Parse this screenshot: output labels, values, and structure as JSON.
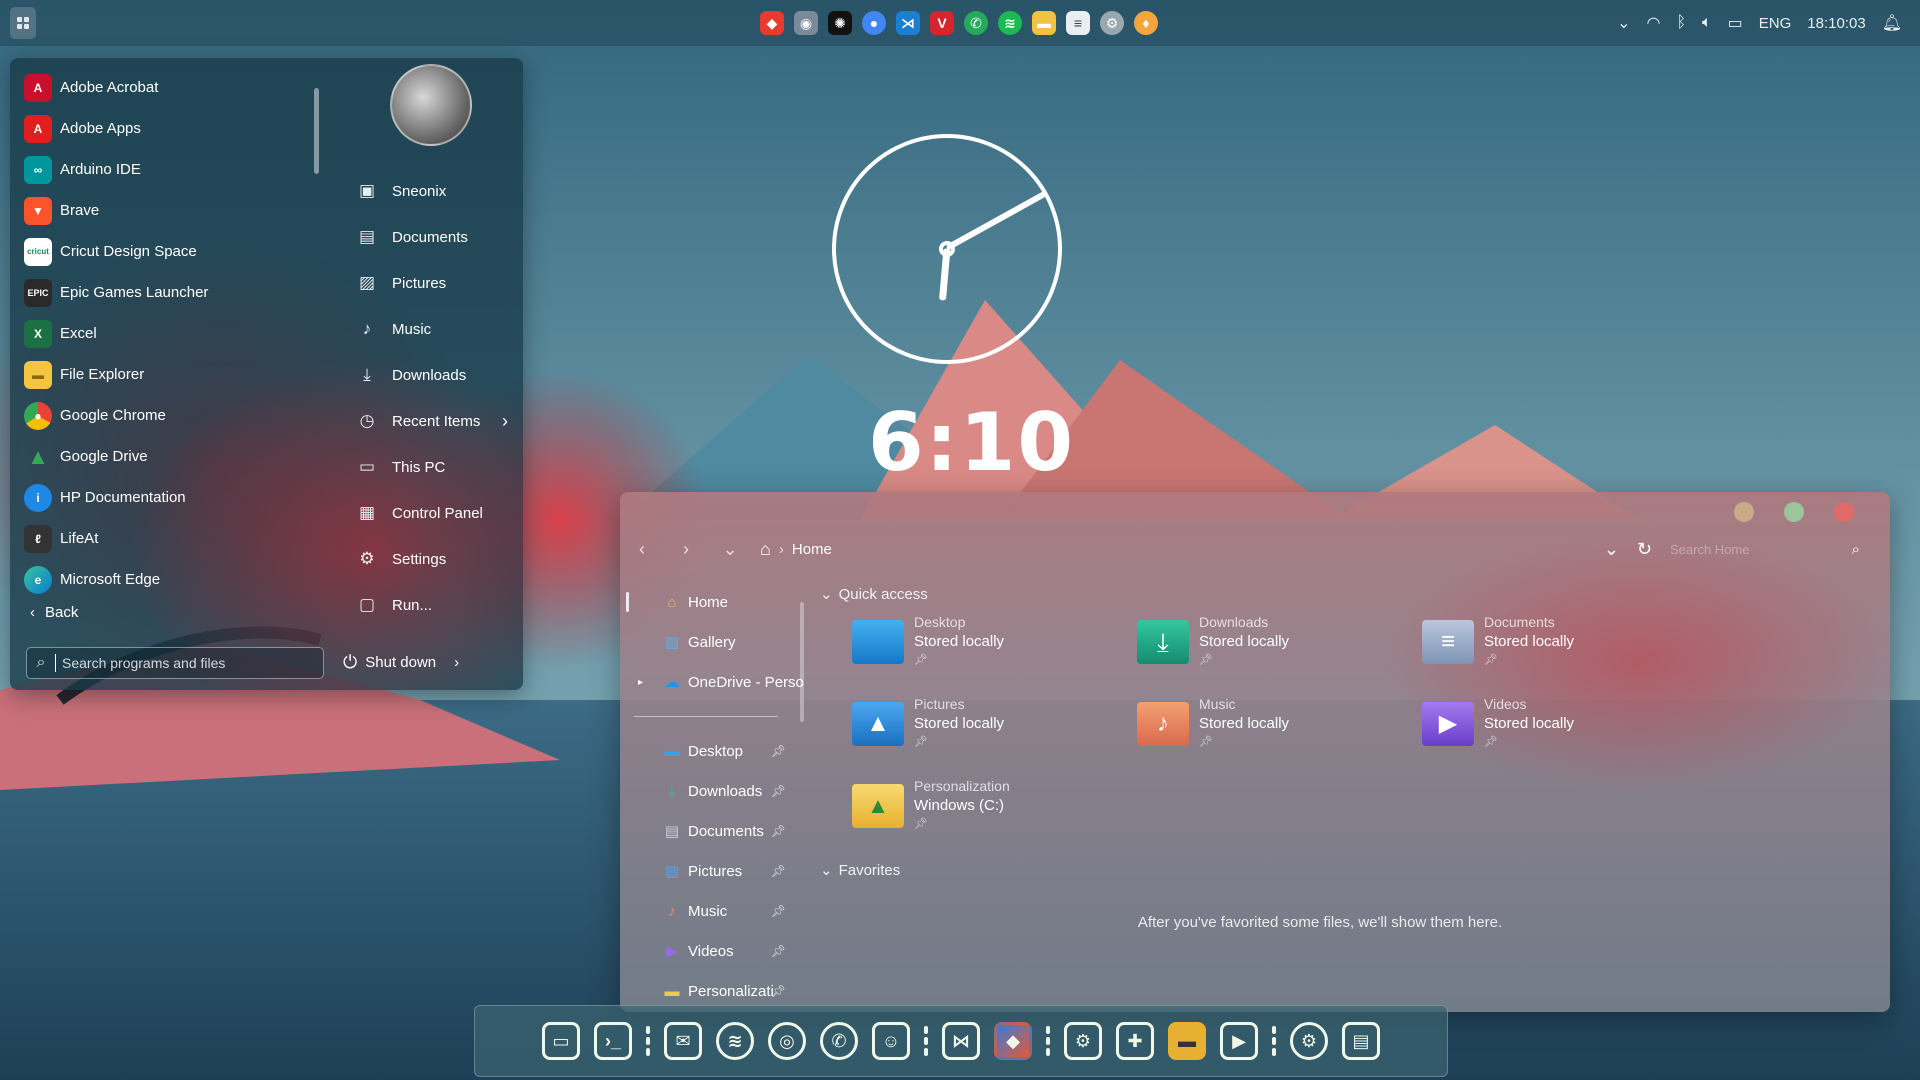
{
  "topbar": {
    "tray": {
      "language": "ENG",
      "time": "18:10:03"
    },
    "pinned_icons": [
      "app-icon",
      "camera-icon",
      "openai-icon",
      "chrome-icon",
      "vscode-icon",
      "vivaldi-icon",
      "whatsapp-icon",
      "spotify-icon",
      "folder-icon",
      "notepad-icon",
      "settings-icon",
      "drop-icon"
    ]
  },
  "start_menu": {
    "apps": [
      {
        "label": "Adobe Acrobat",
        "icon": "acrobat-icon",
        "color": "#c8102e"
      },
      {
        "label": "Adobe Apps",
        "icon": "adobe-icon",
        "color": "#e01e1e"
      },
      {
        "label": "Arduino IDE",
        "icon": "arduino-icon",
        "color": "#00979c"
      },
      {
        "label": "Brave",
        "icon": "brave-icon",
        "color": "#fb542b"
      },
      {
        "label": "Cricut Design Space",
        "icon": "cricut-icon",
        "color": "#1a8c5b"
      },
      {
        "label": "Epic Games Launcher",
        "icon": "epic-icon",
        "color": "#2a2a2a"
      },
      {
        "label": "Excel",
        "icon": "excel-icon",
        "color": "#1d7044"
      },
      {
        "label": "File Explorer",
        "icon": "file-explorer-icon",
        "color": "#f5c542"
      },
      {
        "label": "Google Chrome",
        "icon": "chrome-icon",
        "color": "#4285f4"
      },
      {
        "label": "Google Drive",
        "icon": "drive-icon",
        "color": "#34a853"
      },
      {
        "label": "HP Documentation",
        "icon": "hp-icon",
        "color": "#1e88e5"
      },
      {
        "label": "LifeAt",
        "icon": "lifeat-icon",
        "color": "#333333"
      },
      {
        "label": "Microsoft Edge",
        "icon": "edge-icon",
        "color": "#0a7cd1"
      }
    ],
    "back_label": "Back",
    "search_placeholder": "Search programs and files",
    "places": [
      {
        "label": "Sneonix",
        "icon": "user-folder-icon"
      },
      {
        "label": "Documents",
        "icon": "document-icon"
      },
      {
        "label": "Pictures",
        "icon": "picture-icon"
      },
      {
        "label": "Music",
        "icon": "music-icon"
      },
      {
        "label": "Downloads",
        "icon": "download-icon"
      },
      {
        "label": "Recent Items",
        "icon": "clock-icon"
      },
      {
        "label": "This PC",
        "icon": "computer-icon"
      },
      {
        "label": "Control Panel",
        "icon": "control-panel-icon"
      },
      {
        "label": "Settings",
        "icon": "gear-icon"
      },
      {
        "label": "Run...",
        "icon": "run-icon"
      }
    ],
    "shutdown_label": "Shut down"
  },
  "clock": {
    "digital": "6:10"
  },
  "explorer": {
    "breadcrumb": "Home",
    "search_placeholder": "Search Home",
    "sidebar_top": [
      {
        "label": "Home",
        "icon": "home-icon"
      },
      {
        "label": "Gallery",
        "icon": "gallery-icon"
      },
      {
        "label": "OneDrive - Perso",
        "icon": "onedrive-icon"
      }
    ],
    "sidebar_pinned": [
      {
        "label": "Desktop",
        "icon": "desktop-icon"
      },
      {
        "label": "Downloads",
        "icon": "download-icon"
      },
      {
        "label": "Documents",
        "icon": "document-icon"
      },
      {
        "label": "Pictures",
        "icon": "picture-icon"
      },
      {
        "label": "Music",
        "icon": "music-icon"
      },
      {
        "label": "Videos",
        "icon": "video-icon"
      },
      {
        "label": "Personalizati",
        "icon": "folder-icon"
      }
    ],
    "quick_access_label": "Quick access",
    "quick_access": [
      {
        "name": "Desktop",
        "sub": "Stored locally",
        "color": "#1e90d8"
      },
      {
        "name": "Downloads",
        "sub": "Stored locally",
        "color": "#20a98a"
      },
      {
        "name": "Documents",
        "sub": "Stored locally",
        "color": "#8aa0c0"
      },
      {
        "name": "Pictures",
        "sub": "Stored locally",
        "color": "#2a8ee0"
      },
      {
        "name": "Music",
        "sub": "Stored locally",
        "color": "#e8845a"
      },
      {
        "name": "Videos",
        "sub": "Stored locally",
        "color": "#8a5ad8"
      },
      {
        "name": "Personalization",
        "sub": "Windows (C:)",
        "color": "#f2c84b"
      }
    ],
    "favorites_label": "Favorites",
    "favorites_empty": "After you've favorited some files, we'll show them here."
  },
  "dock": {
    "groups": [
      [
        "computer-icon",
        "terminal-icon"
      ],
      [
        "mail-icon",
        "spotify-icon",
        "chrome-icon",
        "whatsapp-icon",
        "discord-icon"
      ],
      [
        "vscode-icon",
        "git-icon"
      ],
      [
        "steam-icon",
        "gamepad-icon",
        "folder-icon",
        "media-player-icon"
      ],
      [
        "gear-icon",
        "archive-icon"
      ]
    ]
  }
}
